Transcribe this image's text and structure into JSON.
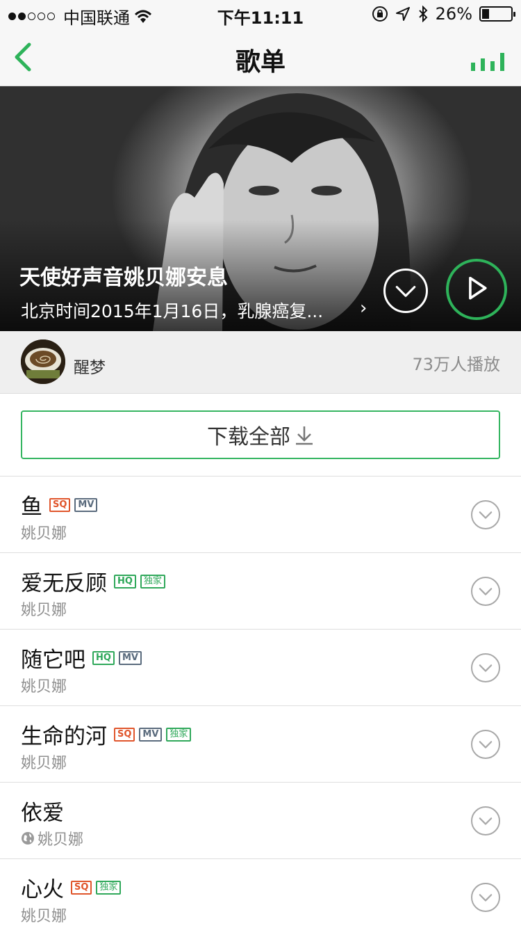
{
  "status_bar": {
    "carrier": "中国联通",
    "time": "下午11:11",
    "battery": "26%",
    "battery_level": 0.26,
    "signal_dots_filled": 2,
    "signal_dots_total": 5
  },
  "nav": {
    "title": "歌单",
    "accent_color": "#2eb35a"
  },
  "playlist": {
    "title": "天使好声音姚贝娜安息",
    "description": "北京时间2015年1月16日，乳腺癌复...",
    "creator": "醒梦",
    "plays": "73万人播放"
  },
  "download": {
    "label": "下载全部"
  },
  "songs": [
    {
      "title": "鱼",
      "artist": "姚贝娜",
      "badges": [
        "SQ",
        "MV"
      ],
      "globe": false
    },
    {
      "title": "爱无反顾",
      "artist": "姚贝娜",
      "badges": [
        "HQ",
        "独家"
      ],
      "globe": false
    },
    {
      "title": "随它吧",
      "artist": "姚贝娜",
      "badges": [
        "HQ",
        "MV"
      ],
      "globe": false
    },
    {
      "title": "生命的河",
      "artist": "姚贝娜",
      "badges": [
        "SQ",
        "MV",
        "独家"
      ],
      "globe": false
    },
    {
      "title": "依爱",
      "artist": "姚贝娜",
      "badges": [],
      "globe": true
    },
    {
      "title": "心火",
      "artist": "姚贝娜",
      "badges": [
        "SQ",
        "独家"
      ],
      "globe": false
    }
  ]
}
